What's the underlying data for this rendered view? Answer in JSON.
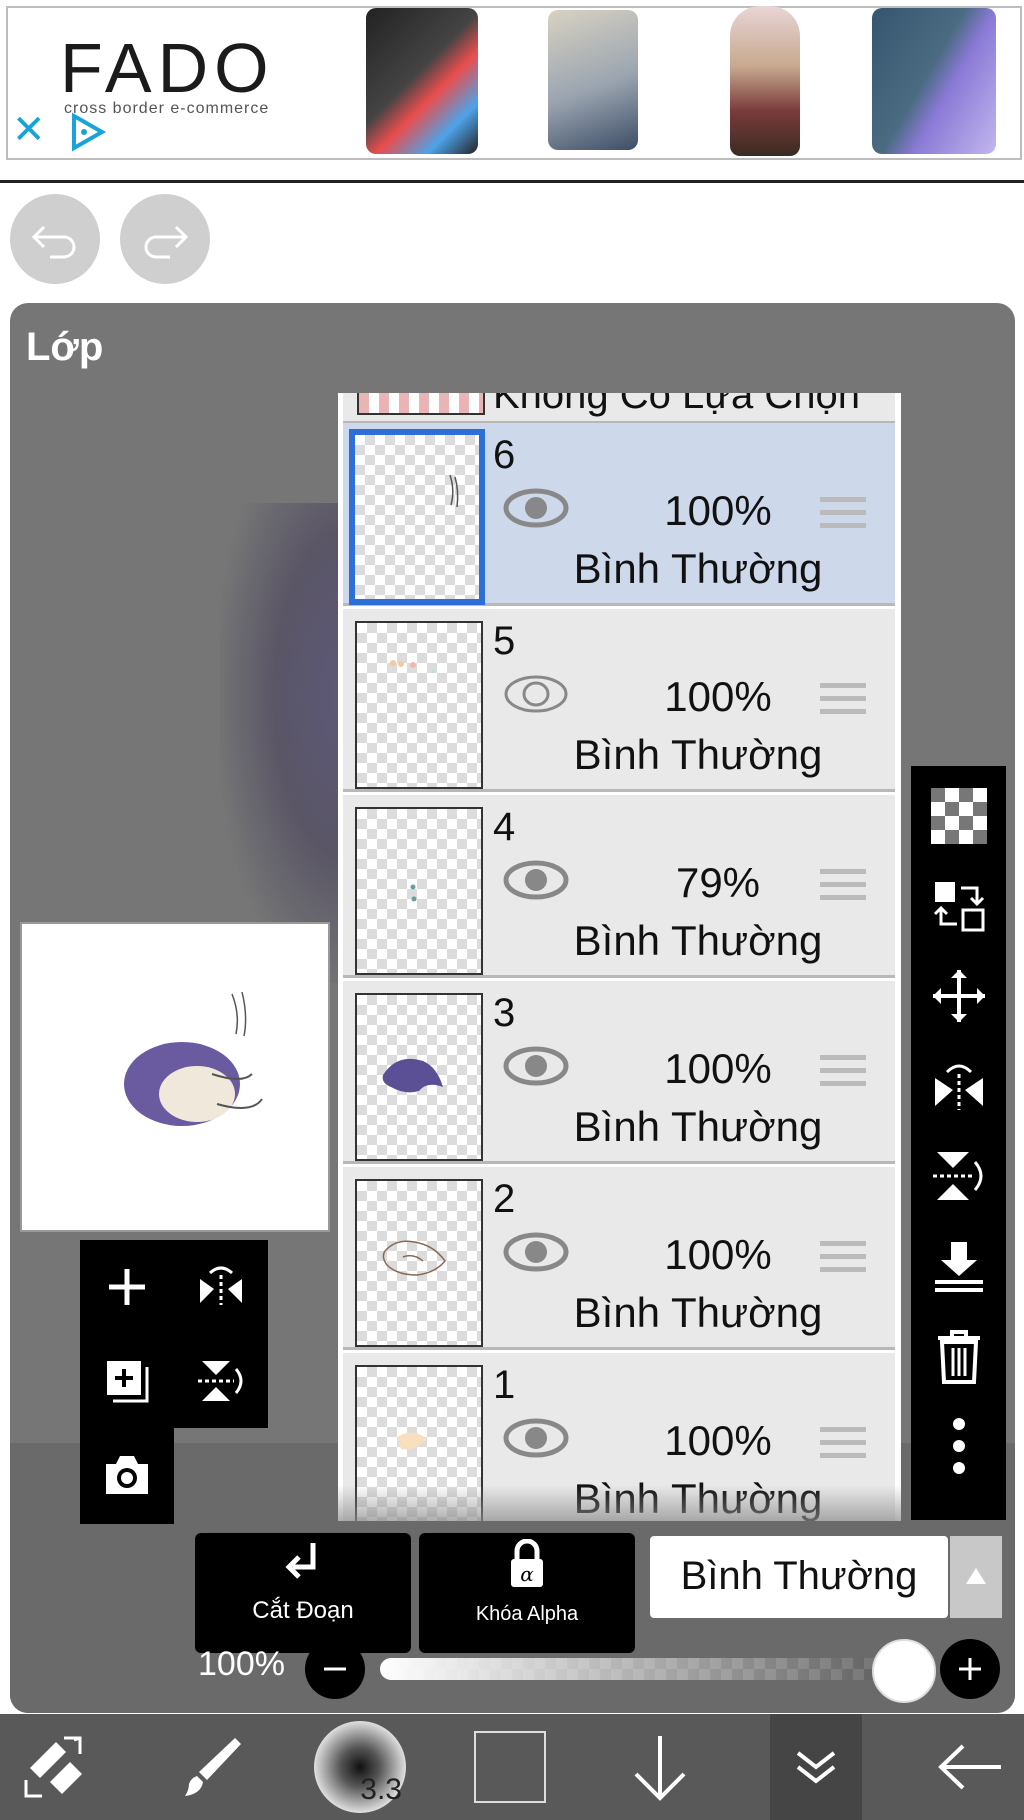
{
  "ad": {
    "brand": "FADO",
    "tagline": "cross border e-commerce",
    "close_icon": "close-icon",
    "play_icon": "ad-choices-icon"
  },
  "panel": {
    "title": "Lớp"
  },
  "layers_header_partial": "Không Có Lựa Chọn",
  "layers": [
    {
      "number": "6",
      "opacity": "100%",
      "blend": "Bình Thường",
      "selected": true
    },
    {
      "number": "5",
      "opacity": "100%",
      "blend": "Bình Thường",
      "selected": false
    },
    {
      "number": "4",
      "opacity": "79%",
      "blend": "Bình Thường",
      "selected": false
    },
    {
      "number": "3",
      "opacity": "100%",
      "blend": "Bình Thường",
      "selected": false
    },
    {
      "number": "2",
      "opacity": "100%",
      "blend": "Bình Thường",
      "selected": false
    },
    {
      "number": "1",
      "opacity": "100%",
      "blend": "Bình Thường",
      "selected": false
    }
  ],
  "actions": {
    "clip_label": "Cắt Đoạn",
    "alpha_lock_label": "Khóa Alpha",
    "blend_mode": "Bình Thường"
  },
  "opacity": {
    "label": "100%",
    "value": 1.0
  },
  "brush_size": "3.3",
  "colors": {
    "panel_bg": "#767676",
    "selected_layer": "#cdd8ea",
    "selected_border": "#2d6fd6",
    "bottom_bar": "#595959"
  }
}
